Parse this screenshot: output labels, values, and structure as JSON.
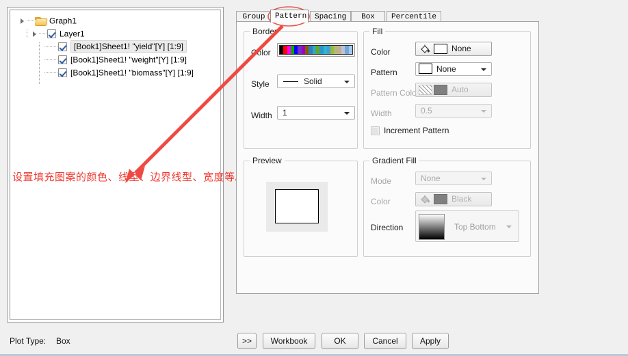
{
  "window": {
    "plot_type_label": "Plot Type:",
    "plot_type_value": "Box"
  },
  "tree": {
    "root": {
      "label": "Graph1",
      "icon": "folder-icon"
    },
    "layer": {
      "label": "Layer1",
      "checked": true
    },
    "plots": [
      {
        "label": "[Book1]Sheet1! \"yield\"[Y] [1:9]",
        "checked": true,
        "selected": true
      },
      {
        "label": "[Book1]Sheet1! \"weight\"[Y] [1:9]",
        "checked": true,
        "selected": false
      },
      {
        "label": "[Book1]Sheet1! \"biomass\"[Y] [1:9]",
        "checked": true,
        "selected": false
      }
    ]
  },
  "tabs": [
    {
      "label": "Group",
      "active": false
    },
    {
      "label": "Pattern",
      "active": true
    },
    {
      "label": "Spacing",
      "active": false
    },
    {
      "label": "Box",
      "active": false
    },
    {
      "label": "Percentile",
      "active": false
    }
  ],
  "border_group": {
    "caption": "Border",
    "color_label": "Color",
    "color_value": "increment-colors",
    "color_swatches": [
      "#000000",
      "#ff0000",
      "#ff00ff",
      "#00aa00",
      "#0000ff",
      "#7b2fbe",
      "#9900cc",
      "#8b5a00",
      "#2f7fbf",
      "#3aa8a8",
      "#5fa832",
      "#2f94c8",
      "#2bb6d6",
      "#4a9ad4",
      "#8fbf3f",
      "#b7b77a",
      "#c8a898",
      "#b9c6cf",
      "#6fa8dc",
      "#a8c8e8"
    ],
    "style_label": "Style",
    "style_value": "Solid",
    "width_label": "Width",
    "width_value": "1"
  },
  "fill_group": {
    "caption": "Fill",
    "color_label": "Color",
    "color_value": "None",
    "pattern_label": "Pattern",
    "pattern_value": "None",
    "pattern_color_label": "Pattern Color",
    "pattern_color_value": "Auto",
    "width_label": "Width",
    "width_value": "0.5",
    "increment_label": "Increment Pattern",
    "increment_checked": false
  },
  "preview_group": {
    "caption": "Preview"
  },
  "gradient_group": {
    "caption": "Gradient Fill",
    "mode_label": "Mode",
    "mode_value": "None",
    "color_label": "Color",
    "color_value": "Black",
    "direction_label": "Direction",
    "direction_value": "Top Bottom"
  },
  "buttons": {
    "expand": ">>",
    "workbook": "Workbook",
    "ok": "OK",
    "cancel": "Cancel",
    "apply": "Apply"
  },
  "annotation": {
    "text": "设置填充图案的颜色、线型、边界线型、宽度等。",
    "color": "#ef3a32"
  }
}
